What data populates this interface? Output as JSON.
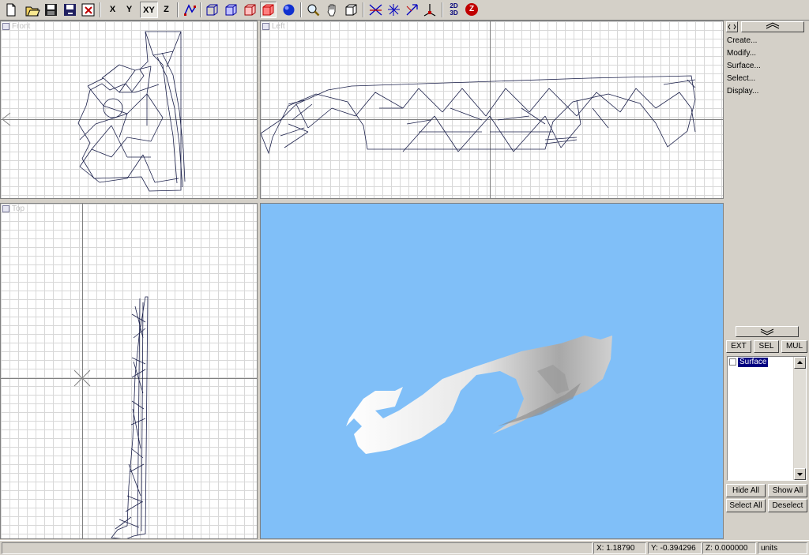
{
  "toolbar": {
    "buttons": [
      {
        "name": "new-file-icon"
      },
      {
        "name": "open-folder-icon"
      },
      {
        "name": "save-icon"
      },
      {
        "name": "save-as-icon"
      },
      {
        "name": "revert-icon"
      },
      {
        "name": "axis-x-button",
        "label": "X"
      },
      {
        "name": "axis-y-button",
        "label": "Y"
      },
      {
        "name": "axis-xy-button",
        "label": "XY",
        "selected": true
      },
      {
        "name": "axis-z-button",
        "label": "Z"
      },
      {
        "name": "select-points-icon"
      },
      {
        "name": "box-view-icon"
      },
      {
        "name": "box-wire-icon"
      },
      {
        "name": "box-shaded-icon"
      },
      {
        "name": "box-red-icon",
        "selected": true
      },
      {
        "name": "sphere-render-icon"
      },
      {
        "name": "zoom-icon"
      },
      {
        "name": "pan-hand-icon"
      },
      {
        "name": "extents-box-icon"
      },
      {
        "name": "transform-cross-icon"
      },
      {
        "name": "star-tool-icon"
      },
      {
        "name": "arrow-tool-icon"
      },
      {
        "name": "axis-tool-icon"
      },
      {
        "name": "2d-3d-toggle-icon",
        "label_top": "2D",
        "label_bottom": "3D"
      },
      {
        "name": "z-circle-icon",
        "label": "Z"
      }
    ]
  },
  "viewports": {
    "front": {
      "label": "Front"
    },
    "left": {
      "label": "Left"
    },
    "top": {
      "label": "Top"
    }
  },
  "panel": {
    "menu": [
      "Create...",
      "Modify...",
      "Surface...",
      "Select...",
      "Display..."
    ],
    "filter_buttons": [
      "EXT",
      "SEL",
      "MUL"
    ],
    "list_items": [
      {
        "label": "Surface",
        "checked": false,
        "selected": true
      }
    ],
    "bottom_buttons": [
      "Hide All",
      "Show All",
      "Select All",
      "Deselect"
    ]
  },
  "status": {
    "x": "X:  1.18790",
    "y": "Y:  -0.394296",
    "z": "Z:  0.000000",
    "units": "units"
  },
  "colors": {
    "wire": "#1a1f4a",
    "render_bg": "#80bff8",
    "grid": "#d8d8d8",
    "list_selection": "#000080"
  }
}
